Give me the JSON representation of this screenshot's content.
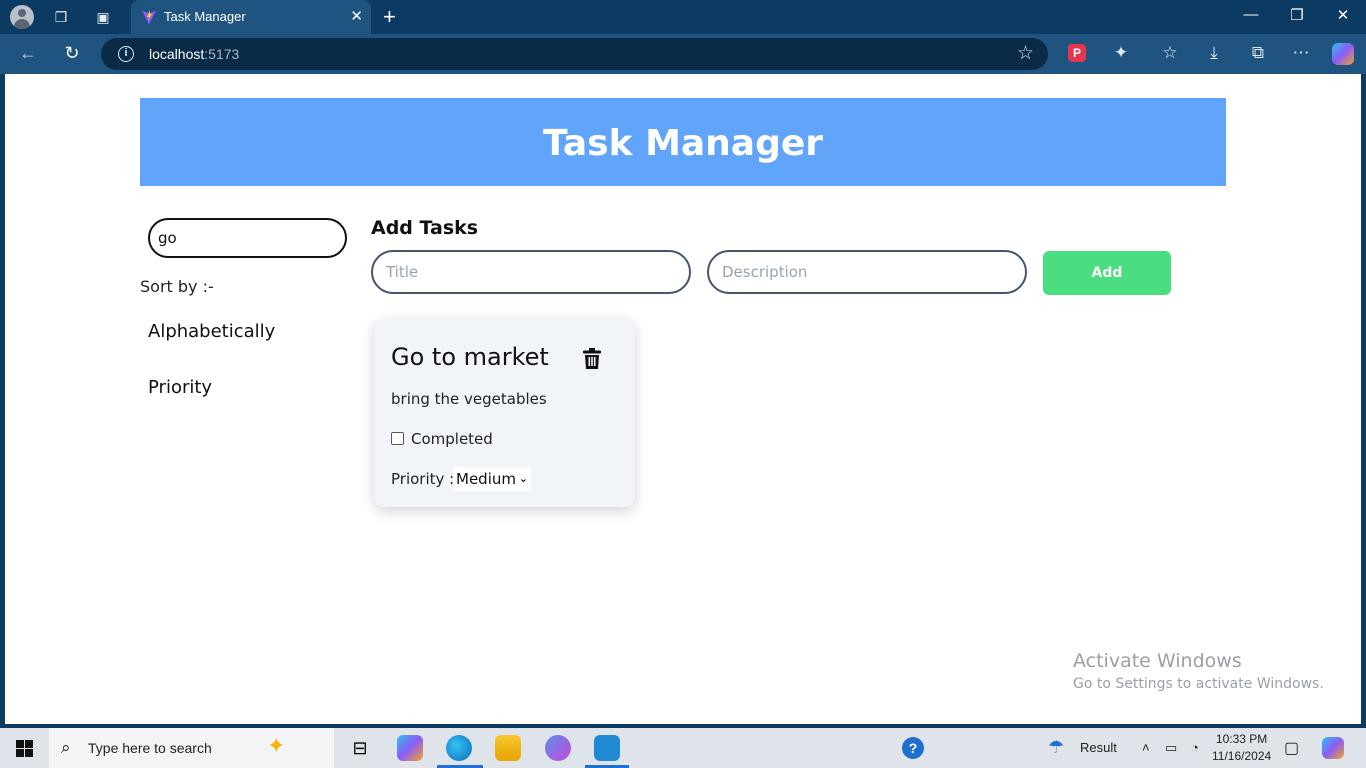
{
  "browser": {
    "tab_title": "Task Manager",
    "url_host": "localhost",
    "url_port": ":5173"
  },
  "app": {
    "title": "Task Manager",
    "search_value": "go",
    "sort_label": "Sort by :-",
    "sort_options": [
      "Alphabetically",
      "Priority"
    ],
    "add_heading": "Add Tasks",
    "title_placeholder": "Title",
    "description_placeholder": "Description",
    "add_button": "Add",
    "tasks": [
      {
        "title": "Go to market",
        "description": "bring the vegetables",
        "completed_label": "Completed",
        "completed": false,
        "priority_label": "Priority :",
        "priority": "Medium"
      }
    ]
  },
  "watermark": {
    "line1": "Activate Windows",
    "line2": "Go to Settings to activate Windows."
  },
  "taskbar": {
    "search_text": "Type here to search",
    "weather": "Result",
    "time": "10:33 PM",
    "date": "11/16/2024"
  },
  "colors": {
    "header": "#60a5fa",
    "add_button": "#4ade80",
    "card": "#f1f5f9"
  }
}
